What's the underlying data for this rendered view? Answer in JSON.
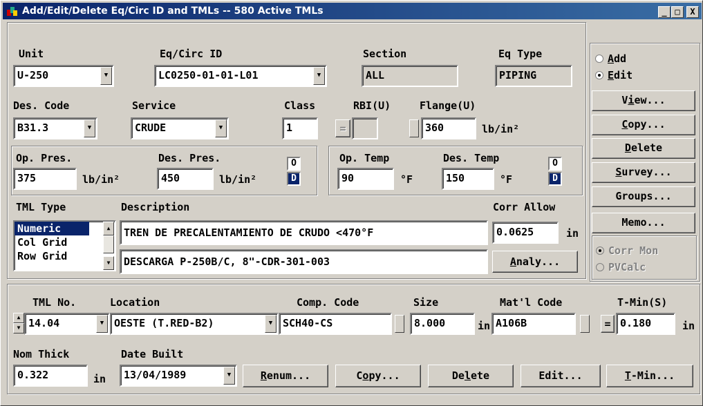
{
  "window": {
    "title": "Add/Edit/Delete Eq/Circ ID and TMLs -- 580 Active TMLs",
    "min": "_",
    "max": "□",
    "close": "X"
  },
  "equipment": {
    "unit_label": "Unit",
    "unit_value": "U-250",
    "eqcirc_label": "Eq/Circ ID",
    "eqcirc_value": "LC0250-01-01-L01",
    "section_label": "Section",
    "section_value": "ALL",
    "eqtype_label": "Eq Type",
    "eqtype_value": "PIPING",
    "descode_label": "Des. Code",
    "descode_value": "B31.3",
    "service_label": "Service",
    "service_value": "CRUDE",
    "class_label": "Class",
    "class_value": "1",
    "rbi_label": "RBI(U)",
    "rbi_btn": "=",
    "rbi_value": "",
    "flange_label": "Flange(U)",
    "flange_value": "360",
    "flange_unit": "lb/in²"
  },
  "pressure": {
    "op_label": "Op. Pres.",
    "op_value": "375",
    "op_unit": "lb/in²",
    "des_label": "Des. Pres.",
    "des_value": "450",
    "des_unit": "lb/in²",
    "o_btn": "O",
    "d_btn": "D"
  },
  "temperature": {
    "op_label": "Op. Temp",
    "op_value": "90",
    "op_unit": "°F",
    "des_label": "Des. Temp",
    "des_value": "150",
    "des_unit": "°F",
    "o_btn": "O",
    "d_btn": "D"
  },
  "tmltype": {
    "label": "TML Type",
    "options": [
      "Numeric",
      "Col Grid",
      "Row Grid"
    ],
    "selected": "Numeric"
  },
  "description": {
    "label": "Description",
    "line1": "TREN DE PRECALENTAMIENTO DE CRUDO <470°F",
    "line2": "DESCARGA P-250B/C, 8\"-CDR-301-003"
  },
  "corr": {
    "label": "Corr Allow",
    "value": "0.0625",
    "unit": "in",
    "analy_btn": "Analy...",
    "analy_ul": "A",
    "analy_rest": "naly..."
  },
  "side": {
    "add": "Add",
    "add_ul": "A",
    "add_rest": "dd",
    "edit": "Edit",
    "edit_ul": "E",
    "edit_rest": "dit",
    "view_pre": "V",
    "view_ul": "i",
    "view_rest": "ew...",
    "copy_ul": "C",
    "copy_rest": "opy...",
    "delete_ul": "D",
    "delete_rest": "elete",
    "survey_ul": "S",
    "survey_rest": "urvey...",
    "groups": "Groups...",
    "memo": "Memo...",
    "corrmon": "Corr Mon",
    "pvcalc": "PVCalc"
  },
  "tml": {
    "no_label": "TML No.",
    "no_value": "14.04",
    "loc_label": "Location",
    "loc_value": "OESTE (T.RED-B2)",
    "comp_label": "Comp. Code",
    "comp_value": "SCH40-CS",
    "size_label": "Size",
    "size_value": "8.000",
    "size_unit": "in",
    "mat_label": "Mat'l Code",
    "mat_value": "A106B",
    "tmin_label": "T-Min(S)",
    "tmin_btn": "=",
    "tmin_value": "0.180",
    "tmin_unit": "in",
    "nom_label": "Nom Thick",
    "nom_value": "0.322",
    "nom_unit": "in",
    "date_label": "Date Built",
    "date_value": "13/04/1989",
    "renum_ul": "R",
    "renum_rest": "enum...",
    "copy_pre": "C",
    "copy_ul": "o",
    "copy_rest": "py...",
    "delete_pre": "De",
    "delete_ul": "l",
    "delete_rest": "ete",
    "edit_btn": "Edit...",
    "tminbtn_ul": "T",
    "tminbtn_rest": "-Min..."
  }
}
